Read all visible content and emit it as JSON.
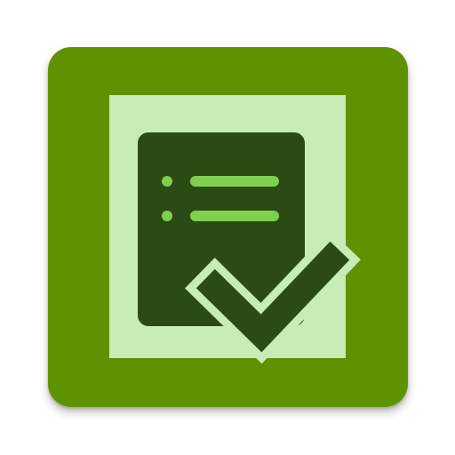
{
  "app_icon": {
    "icon_name": "checklist-document-icon",
    "colors": {
      "tile_background": "#5f9200",
      "inner_panel": "#c7ecb6",
      "document": "#2c4a14",
      "list_lines": "#7fd04f",
      "checkmark": "#2c4a14"
    }
  }
}
